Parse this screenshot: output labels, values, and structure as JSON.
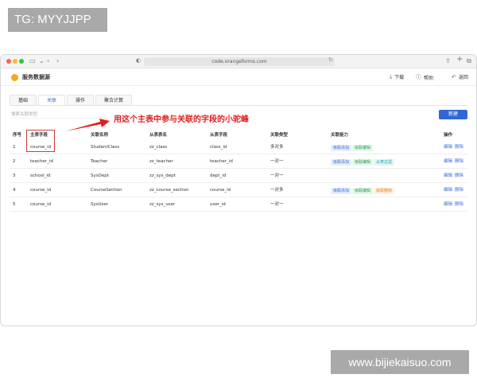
{
  "watermarks": {
    "top": "TG: MYYJJPP",
    "bottom": "www.bijiekaisuo.com"
  },
  "browser": {
    "url": "code.orangeforms.com"
  },
  "app": {
    "title": "服务数据源",
    "actions": {
      "download": "下载",
      "help": "帮助",
      "back": "返回"
    }
  },
  "tabs": [
    {
      "label": "基础",
      "active": false
    },
    {
      "label": "关联",
      "active": true
    },
    {
      "label": "操作",
      "active": false
    },
    {
      "label": "聚合计算",
      "active": false
    }
  ],
  "toolbar": {
    "search_placeholder": "搜索关联类型",
    "new_label": "新建"
  },
  "annotation": "用这个主表中参与关联的字段的小驼峰",
  "table": {
    "headers": [
      "序号",
      "主表字段",
      "关联名称",
      "从表表名",
      "从表字段",
      "关联类型",
      "关联能力",
      "操作"
    ],
    "rows": [
      {
        "no": "1",
        "main_field": "course_id",
        "name": "StudentClass",
        "slave_table": "zz_class",
        "slave_field": "class_id",
        "type": "多对多",
        "caps": [
          {
            "text": "级联添加",
            "color": "blue"
          },
          {
            "text": "级联编辑",
            "color": "green"
          }
        ]
      },
      {
        "no": "2",
        "main_field": "teacher_id",
        "name": "Teacher",
        "slave_table": "zz_teacher",
        "slave_field": "teacher_id",
        "type": "一对一",
        "caps": [
          {
            "text": "级联添加",
            "color": "blue"
          },
          {
            "text": "级联编辑",
            "color": "green"
          },
          {
            "text": "从表过滤",
            "color": "cyan"
          }
        ]
      },
      {
        "no": "3",
        "main_field": "school_id",
        "name": "SysDept",
        "slave_table": "zz_sys_dept",
        "slave_field": "dept_id",
        "type": "一对一",
        "caps": []
      },
      {
        "no": "4",
        "main_field": "course_id",
        "name": "CourseSection",
        "slave_table": "zz_course_section",
        "slave_field": "course_id",
        "type": "一对多",
        "caps": [
          {
            "text": "级联添加",
            "color": "blue"
          },
          {
            "text": "级联编辑",
            "color": "green"
          },
          {
            "text": "级联删除",
            "color": "orange"
          }
        ]
      },
      {
        "no": "5",
        "main_field": "course_id",
        "name": "SysUser",
        "slave_table": "zz_sys_user",
        "slave_field": "user_id",
        "type": "一对一",
        "caps": []
      }
    ],
    "row_actions": {
      "edit": "编辑",
      "delete": "删除"
    }
  }
}
